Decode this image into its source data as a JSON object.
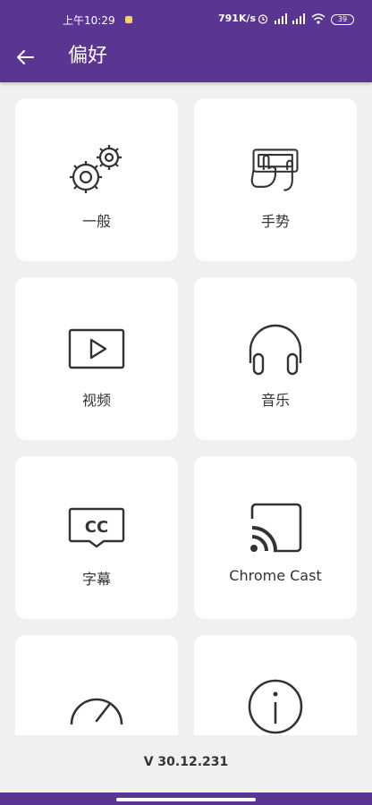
{
  "status": {
    "time": "上午10:29",
    "network_speed": "791K/s",
    "battery": "39"
  },
  "appbar": {
    "title": "偏好",
    "back_icon": "arrow-back-icon"
  },
  "cards": [
    {
      "label": "一般",
      "icon": "gears-icon"
    },
    {
      "label": "手势",
      "icon": "gesture-icon"
    },
    {
      "label": "视频",
      "icon": "video-play-icon"
    },
    {
      "label": "音乐",
      "icon": "headphones-icon"
    },
    {
      "label": "字幕",
      "icon": "subtitles-icon"
    },
    {
      "label": "Chrome Cast",
      "icon": "cast-icon"
    },
    {
      "label": "",
      "icon": "speedometer-icon"
    },
    {
      "label": "",
      "icon": "info-icon"
    }
  ],
  "footer": {
    "version": "V 30.12.231"
  },
  "colors": {
    "primary": "#5a3592",
    "background": "#f0f0f0",
    "card": "#ffffff",
    "icon": "#333333"
  }
}
